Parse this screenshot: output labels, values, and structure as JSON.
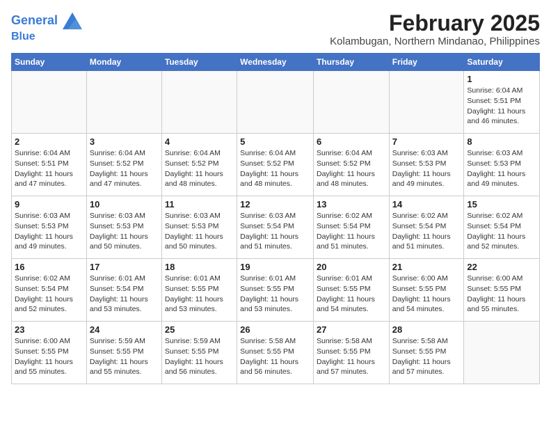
{
  "header": {
    "logo_line1": "General",
    "logo_line2": "Blue",
    "main_title": "February 2025",
    "subtitle": "Kolambugan, Northern Mindanao, Philippines"
  },
  "weekdays": [
    "Sunday",
    "Monday",
    "Tuesday",
    "Wednesday",
    "Thursday",
    "Friday",
    "Saturday"
  ],
  "weeks": [
    [
      {
        "day": "",
        "info": ""
      },
      {
        "day": "",
        "info": ""
      },
      {
        "day": "",
        "info": ""
      },
      {
        "day": "",
        "info": ""
      },
      {
        "day": "",
        "info": ""
      },
      {
        "day": "",
        "info": ""
      },
      {
        "day": "1",
        "info": "Sunrise: 6:04 AM\nSunset: 5:51 PM\nDaylight: 11 hours and 46 minutes."
      }
    ],
    [
      {
        "day": "2",
        "info": "Sunrise: 6:04 AM\nSunset: 5:51 PM\nDaylight: 11 hours and 47 minutes."
      },
      {
        "day": "3",
        "info": "Sunrise: 6:04 AM\nSunset: 5:52 PM\nDaylight: 11 hours and 47 minutes."
      },
      {
        "day": "4",
        "info": "Sunrise: 6:04 AM\nSunset: 5:52 PM\nDaylight: 11 hours and 48 minutes."
      },
      {
        "day": "5",
        "info": "Sunrise: 6:04 AM\nSunset: 5:52 PM\nDaylight: 11 hours and 48 minutes."
      },
      {
        "day": "6",
        "info": "Sunrise: 6:04 AM\nSunset: 5:52 PM\nDaylight: 11 hours and 48 minutes."
      },
      {
        "day": "7",
        "info": "Sunrise: 6:03 AM\nSunset: 5:53 PM\nDaylight: 11 hours and 49 minutes."
      },
      {
        "day": "8",
        "info": "Sunrise: 6:03 AM\nSunset: 5:53 PM\nDaylight: 11 hours and 49 minutes."
      }
    ],
    [
      {
        "day": "9",
        "info": "Sunrise: 6:03 AM\nSunset: 5:53 PM\nDaylight: 11 hours and 49 minutes."
      },
      {
        "day": "10",
        "info": "Sunrise: 6:03 AM\nSunset: 5:53 PM\nDaylight: 11 hours and 50 minutes."
      },
      {
        "day": "11",
        "info": "Sunrise: 6:03 AM\nSunset: 5:53 PM\nDaylight: 11 hours and 50 minutes."
      },
      {
        "day": "12",
        "info": "Sunrise: 6:03 AM\nSunset: 5:54 PM\nDaylight: 11 hours and 51 minutes."
      },
      {
        "day": "13",
        "info": "Sunrise: 6:02 AM\nSunset: 5:54 PM\nDaylight: 11 hours and 51 minutes."
      },
      {
        "day": "14",
        "info": "Sunrise: 6:02 AM\nSunset: 5:54 PM\nDaylight: 11 hours and 51 minutes."
      },
      {
        "day": "15",
        "info": "Sunrise: 6:02 AM\nSunset: 5:54 PM\nDaylight: 11 hours and 52 minutes."
      }
    ],
    [
      {
        "day": "16",
        "info": "Sunrise: 6:02 AM\nSunset: 5:54 PM\nDaylight: 11 hours and 52 minutes."
      },
      {
        "day": "17",
        "info": "Sunrise: 6:01 AM\nSunset: 5:54 PM\nDaylight: 11 hours and 53 minutes."
      },
      {
        "day": "18",
        "info": "Sunrise: 6:01 AM\nSunset: 5:55 PM\nDaylight: 11 hours and 53 minutes."
      },
      {
        "day": "19",
        "info": "Sunrise: 6:01 AM\nSunset: 5:55 PM\nDaylight: 11 hours and 53 minutes."
      },
      {
        "day": "20",
        "info": "Sunrise: 6:01 AM\nSunset: 5:55 PM\nDaylight: 11 hours and 54 minutes."
      },
      {
        "day": "21",
        "info": "Sunrise: 6:00 AM\nSunset: 5:55 PM\nDaylight: 11 hours and 54 minutes."
      },
      {
        "day": "22",
        "info": "Sunrise: 6:00 AM\nSunset: 5:55 PM\nDaylight: 11 hours and 55 minutes."
      }
    ],
    [
      {
        "day": "23",
        "info": "Sunrise: 6:00 AM\nSunset: 5:55 PM\nDaylight: 11 hours and 55 minutes."
      },
      {
        "day": "24",
        "info": "Sunrise: 5:59 AM\nSunset: 5:55 PM\nDaylight: 11 hours and 55 minutes."
      },
      {
        "day": "25",
        "info": "Sunrise: 5:59 AM\nSunset: 5:55 PM\nDaylight: 11 hours and 56 minutes."
      },
      {
        "day": "26",
        "info": "Sunrise: 5:58 AM\nSunset: 5:55 PM\nDaylight: 11 hours and 56 minutes."
      },
      {
        "day": "27",
        "info": "Sunrise: 5:58 AM\nSunset: 5:55 PM\nDaylight: 11 hours and 57 minutes."
      },
      {
        "day": "28",
        "info": "Sunrise: 5:58 AM\nSunset: 5:55 PM\nDaylight: 11 hours and 57 minutes."
      },
      {
        "day": "",
        "info": ""
      }
    ]
  ]
}
